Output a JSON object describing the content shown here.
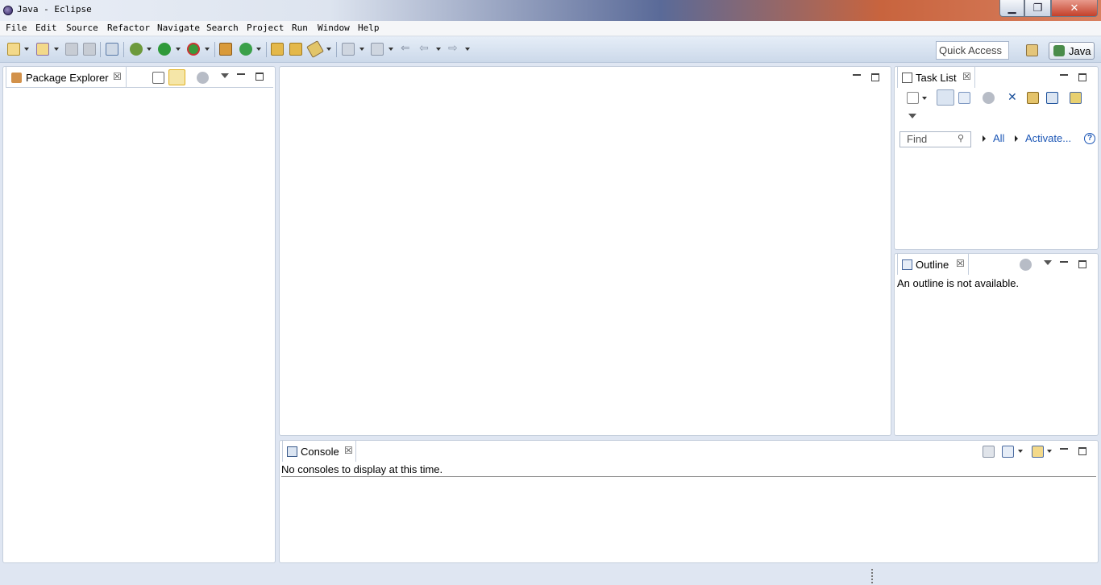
{
  "window": {
    "title": "Java - Eclipse"
  },
  "menu": [
    "File",
    "Edit",
    "Source",
    "Refactor",
    "Navigate",
    "Search",
    "Project",
    "Run",
    "Window",
    "Help"
  ],
  "toolbar": {
    "quick_access": "Quick Access",
    "perspective_label": "Java",
    "icons": [
      "new-icon",
      "new-package-icon",
      "save-icon",
      "save-all-icon",
      "toggle-breakpoint-icon",
      "debug-icon",
      "run-icon",
      "external-tools-icon",
      "new-java-class-icon",
      "open-type-icon",
      "open-task-icon",
      "search-icon",
      "annotation-next-icon",
      "annotation-previous-icon",
      "back-icon",
      "forward-icon"
    ]
  },
  "package_explorer": {
    "tab_label": "Package Explorer",
    "close": "☒"
  },
  "task_list": {
    "tab_label": "Task List",
    "close": "☒",
    "find_placeholder": "Find",
    "all_link": "All",
    "activate_link": "Activate...",
    "help": "?"
  },
  "outline": {
    "tab_label": "Outline",
    "close": "☒",
    "message": "An outline is not available."
  },
  "console": {
    "tab_label": "Console",
    "close": "☒",
    "message": "No consoles to display at this time."
  },
  "colors": {
    "accent": "#1a55b5",
    "panel_border": "#c4cedc",
    "workbench_bg": "#dfe6f2"
  }
}
